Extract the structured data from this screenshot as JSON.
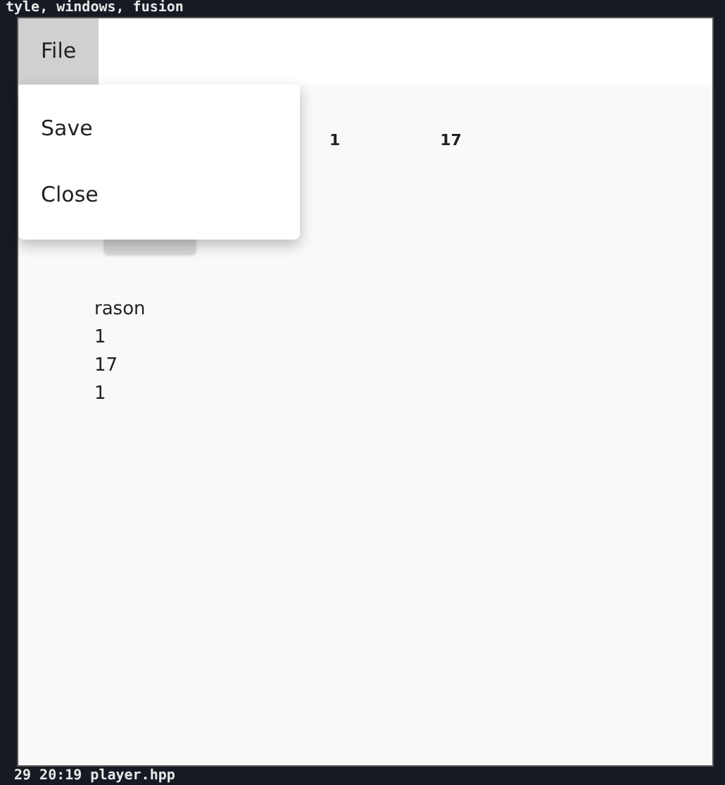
{
  "terminal": {
    "top_line": "tyle, windows, fusion",
    "bottom_line": "29 20:19 player.hpp"
  },
  "menu_bar": {
    "items": [
      {
        "label": "File",
        "selected": true
      }
    ]
  },
  "menu": {
    "items": [
      {
        "label": "Save"
      },
      {
        "label": "Close"
      }
    ]
  },
  "header_row": [
    "1",
    "17"
  ],
  "values": [
    "rason",
    "1",
    "17",
    "1"
  ]
}
